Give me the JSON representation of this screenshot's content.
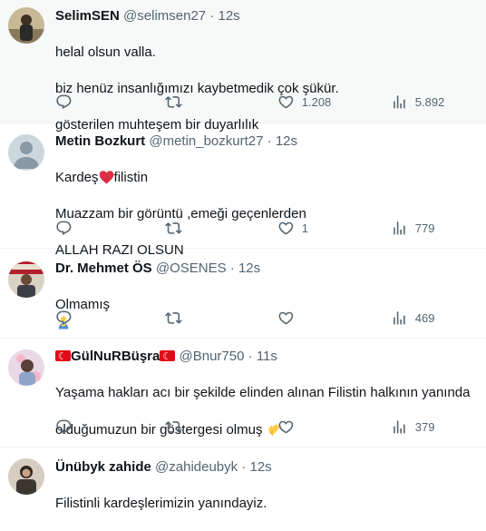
{
  "tweets": [
    {
      "name": "SelimSEN",
      "handle": "@selimsen27",
      "time": "12s",
      "lines": [
        "helal olsun valla.",
        "biz henüz insanlığımızı kaybetmedik çok şükür.",
        "gösterilen muhteşem bir duyarlılık"
      ],
      "likes": "1.208",
      "views": "5.892"
    },
    {
      "name": "Metin Bozkurt",
      "handle": "@metin_bozkurt27",
      "time": "12s",
      "line1_a": "Kardeş",
      "line1_b": "filistin",
      "line2": "Muazzam bir görüntü ,emeği geçenlerden",
      "line3": "ALLAH RAZI OLSUN",
      "likes": "1",
      "views": "779"
    },
    {
      "name": "Dr. Mehmet ÖS",
      "handle": "@OSENES",
      "time": "12s",
      "text": "Olmamış",
      "views": "469"
    },
    {
      "name": "GülNuRBüşra",
      "handle": "@Bnur750",
      "time": "11s",
      "line1": "Yaşama hakları acı bir şekilde elinden alınan Filistin halkının yanında",
      "line2": "olduğumuzun bir göstergesi olmuş",
      "views": "379"
    },
    {
      "name": "Ünübyk zahide",
      "handle": "@zahideubyk",
      "time": "12s",
      "text": "Filistinli kardeşlerimizin yanındayiz."
    }
  ],
  "separator": "·"
}
